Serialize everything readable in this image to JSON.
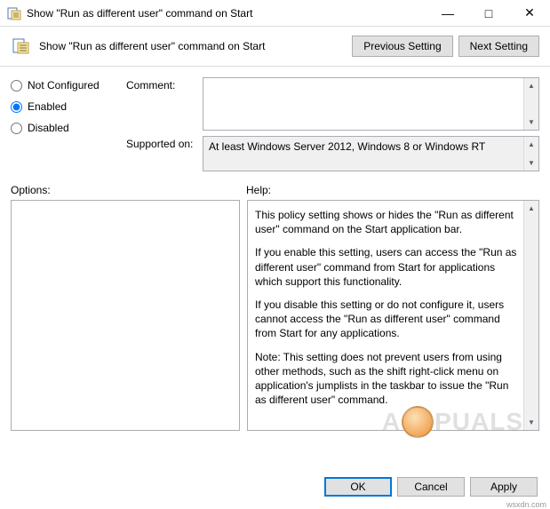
{
  "window": {
    "title": "Show \"Run as different user\" command on Start"
  },
  "header": {
    "title": "Show \"Run as different user\" command on Start",
    "prev_btn": "Previous Setting",
    "next_btn": "Next Setting"
  },
  "radios": {
    "not_configured": "Not Configured",
    "enabled": "Enabled",
    "disabled": "Disabled",
    "selected": "enabled"
  },
  "fields": {
    "comment_label": "Comment:",
    "comment_value": "",
    "supported_label": "Supported on:",
    "supported_value": "At least Windows Server 2012, Windows 8 or Windows RT"
  },
  "sections": {
    "options_label": "Options:",
    "help_label": "Help:"
  },
  "help": {
    "p1": "This policy setting shows or hides the \"Run as different user\" command on the Start application bar.",
    "p2": "If you enable this setting, users can access the \"Run as different user\" command from Start for applications which support this functionality.",
    "p3": "If you disable this setting or do not configure it, users cannot access the \"Run as different user\" command from Start for any applications.",
    "p4": "Note: This setting does not prevent users from using other methods, such as the shift right-click menu on application's jumplists in the taskbar to issue the \"Run as different user\" command."
  },
  "footer": {
    "ok": "OK",
    "cancel": "Cancel",
    "apply": "Apply"
  },
  "watermark": {
    "left": "A",
    "right": "PUALS"
  },
  "source": "wsxdn.com"
}
